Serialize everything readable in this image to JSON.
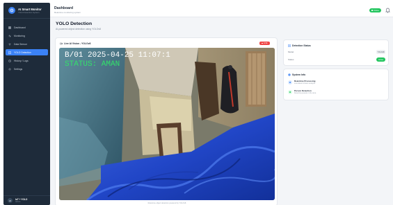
{
  "brand": {
    "title": "AI Smart Monitor",
    "subtitle": "YOLO Detection System"
  },
  "nav": [
    {
      "label": "Dashboard",
      "icon": "grid-icon",
      "active": false
    },
    {
      "label": "Monitoring",
      "icon": "pulse-icon",
      "active": false
    },
    {
      "label": "Data Sensor",
      "icon": "wifi-icon",
      "active": false
    },
    {
      "label": "YOLO Detection",
      "icon": "target-icon",
      "active": true
    },
    {
      "label": "History / Logs",
      "icon": "clock-icon",
      "active": false
    },
    {
      "label": "Settings",
      "icon": "gear-icon",
      "active": false
    }
  ],
  "user": {
    "initials": "AI",
    "name": "IoT + YOLO",
    "role": "Admin"
  },
  "header": {
    "title": "Dashboard",
    "subtitle": "Real-time monitoring system",
    "status": "Online"
  },
  "page": {
    "title": "YOLO Detection",
    "subtitle": "AI-powered object detection using YOLOv8"
  },
  "feed": {
    "title": "Live AI Vision - YOLOv8",
    "badge": "LIVE",
    "overlay_time": "B/01 2025-04-25 11:07:1",
    "overlay_status": "STATUS: AMAN",
    "caption": "Real-time object detection powered by YOLOv8"
  },
  "detection_status": {
    "title": "Detection Status",
    "rows": [
      {
        "label": "Model",
        "value": "YOLOv8"
      },
      {
        "label": "Status",
        "value": "Active"
      }
    ]
  },
  "system_info": {
    "title": "System Info",
    "items": [
      {
        "title": "Real-time Processing",
        "desc": "Low-latean stream analysis"
      },
      {
        "title": "Person Detection",
        "desc": "Detecting people in the area"
      }
    ]
  },
  "colors": {
    "sidebar": "#1e2b3a",
    "accent": "#3b82f6",
    "online": "#22c55e",
    "live": "#ef4444",
    "overlay_text": "#33e06b"
  }
}
